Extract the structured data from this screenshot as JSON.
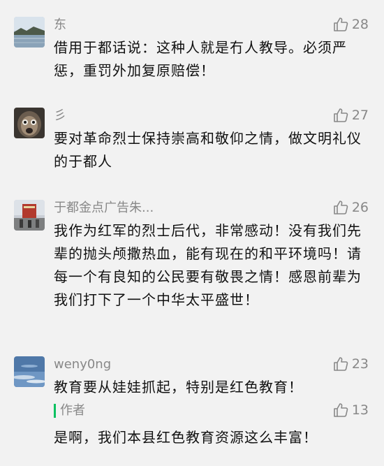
{
  "comments": [
    {
      "username": "东",
      "likes": "28",
      "text": "借用于都话说：这种人就是冇人教导。必须严惩，重罚外加复原赔偿！",
      "avatar": "lake-landscape-avatar"
    },
    {
      "username": "彡",
      "likes": "27",
      "text": "要对革命烈士保持崇高和敬仰之情，做文明礼仪的于都人",
      "avatar": "primate-face-avatar"
    },
    {
      "username": "于都金点广告朱...",
      "likes": "26",
      "text": "我作为红军的烈士后代，非常感动！没有我们先辈的抛头颅撒热血，能有现在的和平环境吗！请每一个有良知的公民要有敬畏之情！感恩前辈为我们打下了一个中华太平盛世！",
      "avatar": "monument-avatar"
    },
    {
      "username": "weny0ng",
      "likes": "23",
      "text": "教育要从娃娃抓起，特别是红色教育！",
      "avatar": "sky-avatar"
    }
  ],
  "reply": {
    "author": "作者",
    "likes": "13",
    "text": "是啊，我们本县红色教育资源这么丰富！"
  },
  "colors": {
    "background": "#f2f2f2",
    "meta_text": "#888888",
    "body_text": "#111111",
    "author_accent": "#07c160"
  },
  "icons": {
    "like": "thumbs-up-outline-icon"
  }
}
